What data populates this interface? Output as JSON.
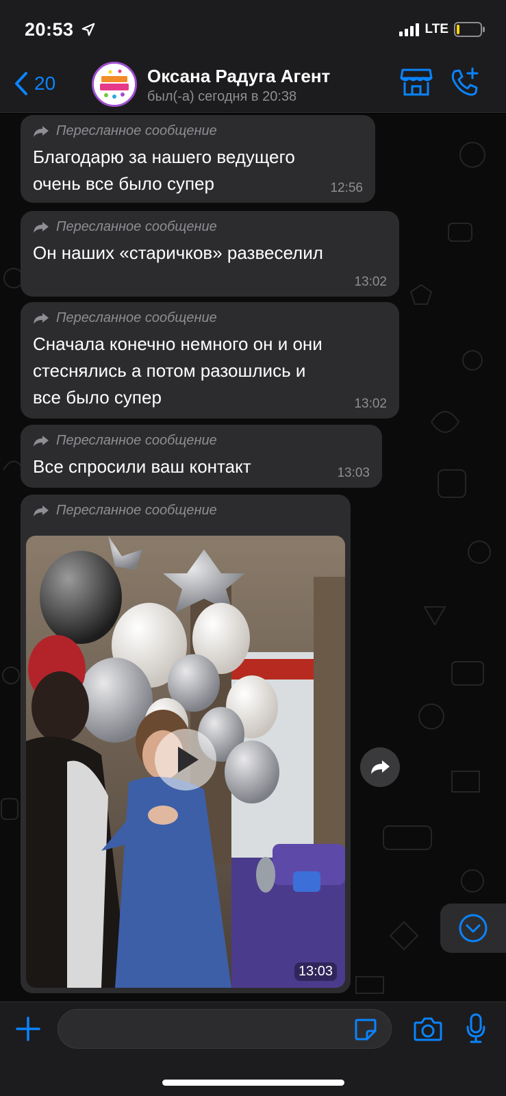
{
  "status_bar": {
    "time": "20:53",
    "network": "LTE",
    "icons": [
      "location-arrow-icon",
      "signal-bars-icon",
      "battery-icon"
    ]
  },
  "header": {
    "back_count": "20",
    "contact_name": "Оксана Радуга Агент",
    "last_seen": "был(-а) сегодня в 20:38",
    "icons": [
      "chevron-left-icon",
      "shop-icon",
      "call-add-icon"
    ],
    "accent_color": "#0a84ff"
  },
  "messages": [
    {
      "forwarded_label": "Пересланное сообщение",
      "lines": [
        "Благодарю за нашего ведущего",
        "очень все было супер"
      ],
      "time": "12:56"
    },
    {
      "forwarded_label": "Пересланное сообщение",
      "lines": [
        "Он наших «старичков» развеселил"
      ],
      "time": "13:02"
    },
    {
      "forwarded_label": "Пересланное сообщение",
      "lines": [
        "Сначала конечно немного он и они",
        "стеснялись а потом разошлись и",
        "все было супер"
      ],
      "time": "13:02"
    },
    {
      "forwarded_label": "Пересланное сообщение",
      "lines": [
        "Все спросили ваш контакт"
      ],
      "time": "13:03"
    },
    {
      "forwarded_label": "Пересланное сообщение",
      "media": "video",
      "time": "13:03"
    }
  ],
  "chat_actions": {
    "icons": [
      "share-forward-icon",
      "chevron-down-circle-icon",
      "play-icon"
    ]
  },
  "input_bar": {
    "placeholder": "",
    "icons": [
      "plus-icon",
      "sticker-icon",
      "camera-icon",
      "microphone-icon"
    ]
  },
  "colors": {
    "bubble": "#2c2c2e",
    "background": "#0b0b0b",
    "secondary_text": "#8e8e93"
  }
}
